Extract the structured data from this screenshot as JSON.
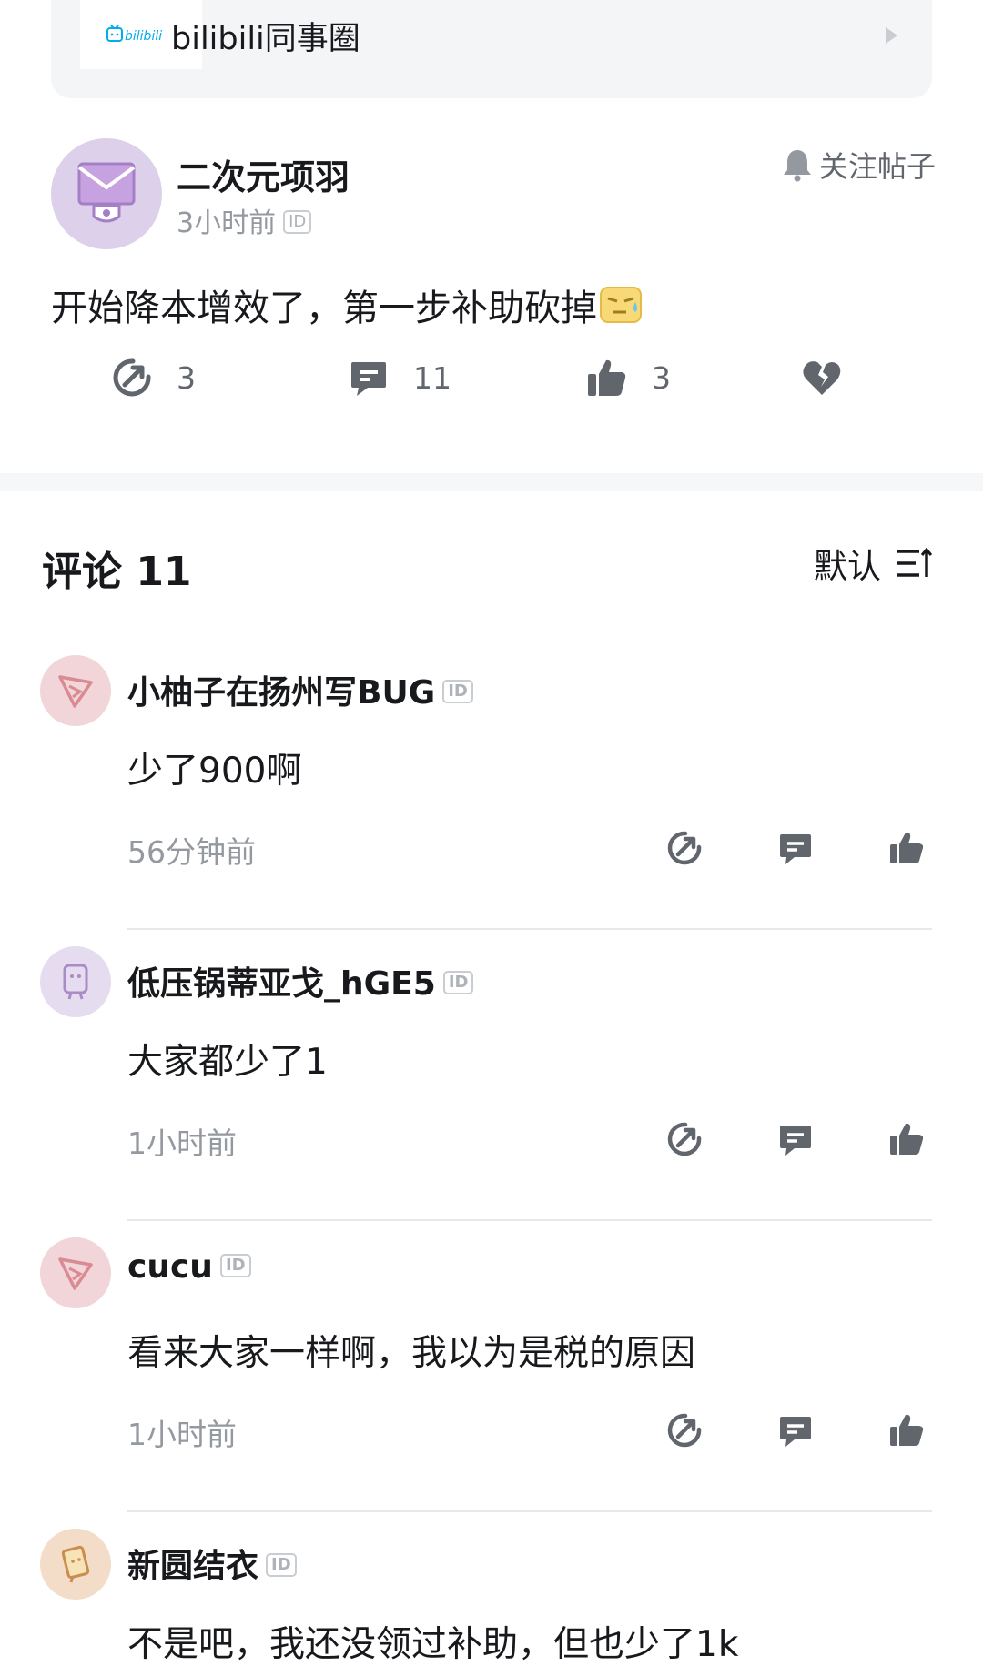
{
  "circle": {
    "logo_text": "bilibili",
    "name": "bilibili同事圈"
  },
  "post": {
    "author": "二次元项羽",
    "time": "3小时前",
    "id_badge": "ID",
    "follow_label": "关注帖子",
    "content": "开始降本增效了，第一步补助砍掉",
    "actions": {
      "share_count": "3",
      "comment_count": "11",
      "like_count": "3"
    }
  },
  "comments_header": {
    "title": "评论 11",
    "sort_label": "默认"
  },
  "comments": [
    {
      "author": "小柚子在扬州写BUG",
      "id_badge": "ID",
      "text": "少了900啊",
      "time": "56分钟前"
    },
    {
      "author": "低压锅蒂亚戈_hGE5",
      "id_badge": "ID",
      "text": "大家都少了1",
      "time": "1小时前"
    },
    {
      "author": "cucu",
      "id_badge": "ID",
      "text": "看来大家一样啊，我以为是税的原因",
      "time": "1小时前"
    },
    {
      "author": "新圆结衣",
      "id_badge": "ID",
      "text": "不是吧，我还没领过补助，但也少了1k",
      "time": ""
    }
  ],
  "colors": {
    "text_primary": "#18191c",
    "text_secondary": "#9499a0",
    "icon_gray": "#61666d",
    "bilibili_blue": "#00aeec",
    "avatar_purple": "#ddd0ea",
    "avatar_pink": "#f2d5d8",
    "avatar_peach": "#f3dcc8"
  }
}
